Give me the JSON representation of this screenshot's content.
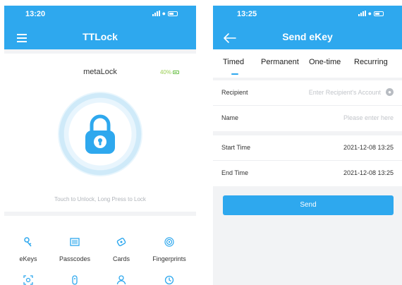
{
  "left": {
    "status": {
      "time": "13:20"
    },
    "title": "TTLock",
    "lock": {
      "name": "metaLock",
      "battery": "40%",
      "hint": "Touch to Unlock, Long Press to Lock"
    },
    "menu": {
      "row1": [
        {
          "label": "eKeys",
          "icon": "key-icon"
        },
        {
          "label": "Passcodes",
          "icon": "passcode-icon"
        },
        {
          "label": "Cards",
          "icon": "card-icon"
        },
        {
          "label": "Fingerprints",
          "icon": "fingerprint-icon"
        }
      ],
      "row2": [
        {
          "icon": "face-icon"
        },
        {
          "icon": "remote-icon"
        },
        {
          "icon": "user-icon"
        },
        {
          "icon": "history-icon"
        }
      ]
    }
  },
  "right": {
    "status": {
      "time": "13:25"
    },
    "title": "Send eKey",
    "tabs": [
      {
        "label": "Timed",
        "active": true
      },
      {
        "label": "Permanent"
      },
      {
        "label": "One-time"
      },
      {
        "label": "Recurring"
      }
    ],
    "form": {
      "recipient_label": "Recipient",
      "recipient_placeholder": "Enter Recipient's Account",
      "name_label": "Name",
      "name_placeholder": "Please enter here",
      "start_label": "Start Time",
      "start_value": "2021-12-08 13:25",
      "end_label": "End Time",
      "end_value": "2021-12-08 13:25"
    },
    "send_label": "Send"
  },
  "colors": {
    "accent": "#2ea8ee",
    "battery": "#6cc04a"
  }
}
